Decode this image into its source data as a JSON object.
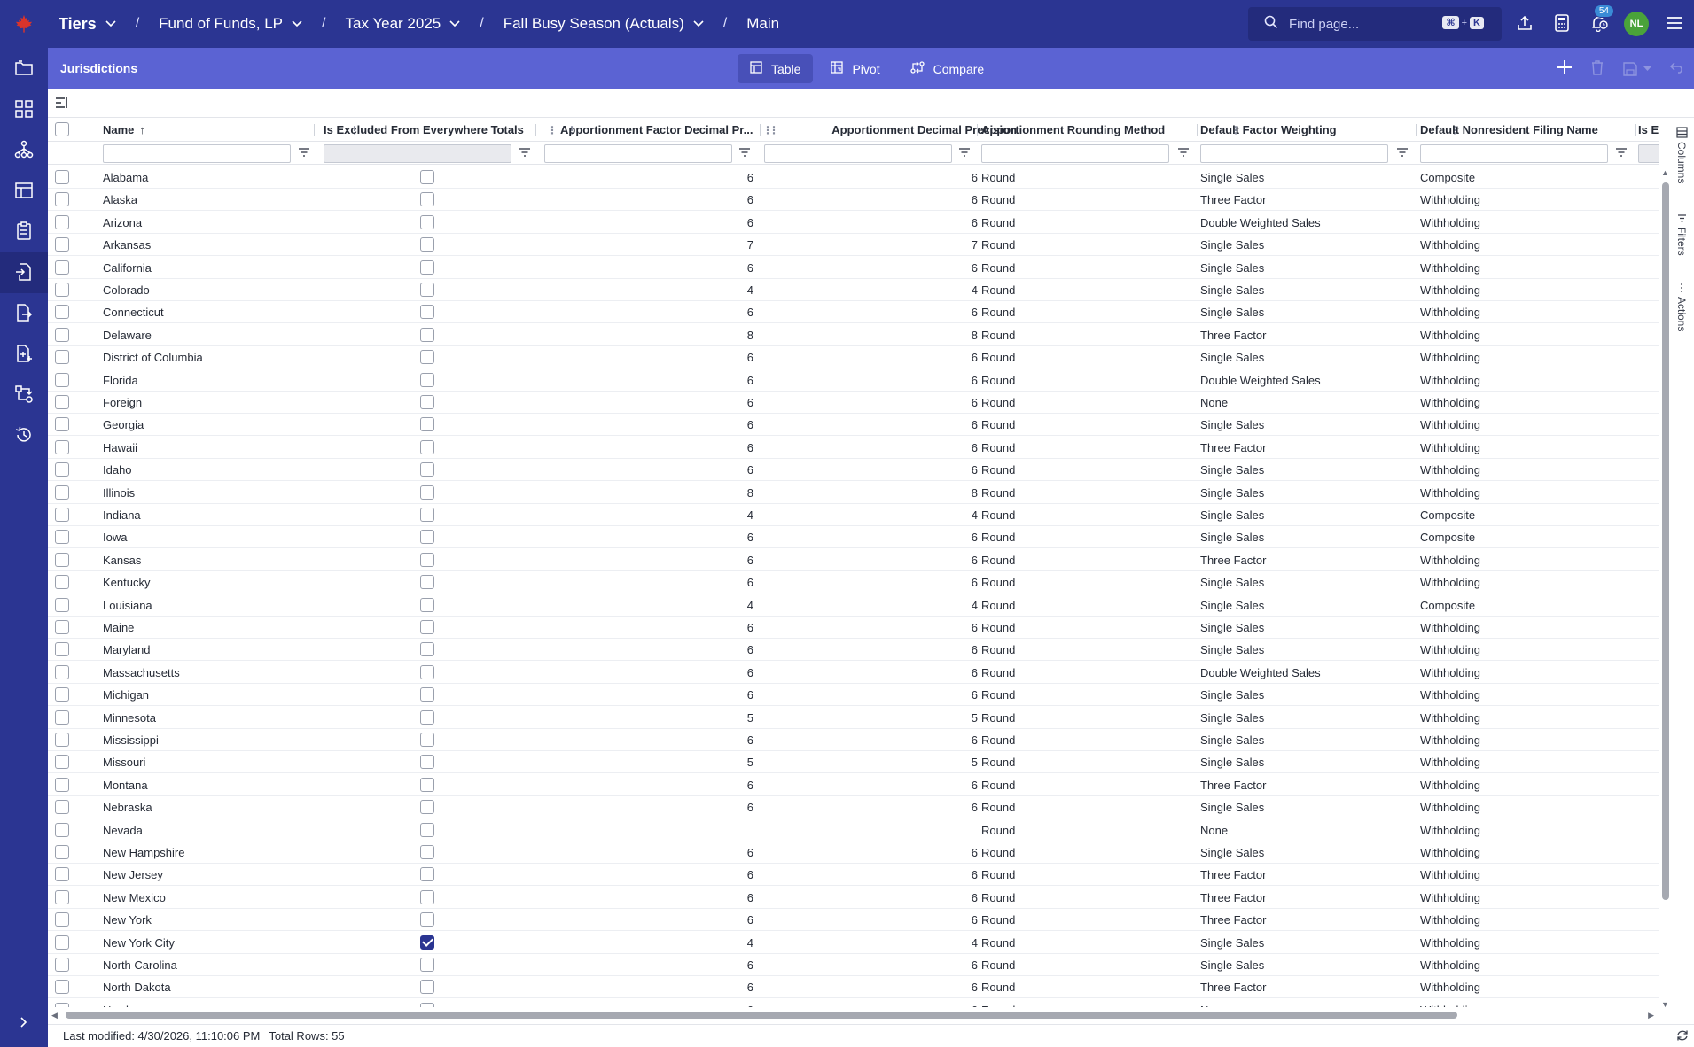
{
  "topbar": {
    "breadcrumbs": [
      "Tiers",
      "Fund of Funds, LP",
      "Tax Year 2025",
      "Fall Busy Season (Actuals)",
      "Main"
    ],
    "search_placeholder": "Find page...",
    "shortcut_mod": "⌘",
    "shortcut_plus": "+",
    "shortcut_key": "K",
    "notification_count": "54",
    "avatar_initials": "NL"
  },
  "subheader": {
    "title": "Jurisdictions",
    "tabs": [
      {
        "label": "Table",
        "icon": "table-icon",
        "active": true
      },
      {
        "label": "Pivot",
        "icon": "pivot-icon",
        "active": false
      },
      {
        "label": "Compare",
        "icon": "compare-icon",
        "active": false
      }
    ]
  },
  "grid": {
    "columns": [
      "Name",
      "Is Excluded From Everywhere Totals",
      "Apportionment Factor Decimal Pr...",
      "Apportionment Decimal Precision",
      "Apportionment Rounding Method",
      "Default Factor Weighting",
      "Default Nonresident Filing Name",
      "Is Excl"
    ],
    "sort_indicator": "↑",
    "rows": [
      [
        "Alabama",
        false,
        "6",
        "6",
        "Round",
        "Single Sales",
        "Composite"
      ],
      [
        "Alaska",
        false,
        "6",
        "6",
        "Round",
        "Three Factor",
        "Withholding"
      ],
      [
        "Arizona",
        false,
        "6",
        "6",
        "Round",
        "Double Weighted Sales",
        "Withholding"
      ],
      [
        "Arkansas",
        false,
        "7",
        "7",
        "Round",
        "Single Sales",
        "Withholding"
      ],
      [
        "California",
        false,
        "6",
        "6",
        "Round",
        "Single Sales",
        "Withholding"
      ],
      [
        "Colorado",
        false,
        "4",
        "4",
        "Round",
        "Single Sales",
        "Withholding"
      ],
      [
        "Connecticut",
        false,
        "6",
        "6",
        "Round",
        "Single Sales",
        "Withholding"
      ],
      [
        "Delaware",
        false,
        "8",
        "8",
        "Round",
        "Three Factor",
        "Withholding"
      ],
      [
        "District of Columbia",
        false,
        "6",
        "6",
        "Round",
        "Single Sales",
        "Withholding"
      ],
      [
        "Florida",
        false,
        "6",
        "6",
        "Round",
        "Double Weighted Sales",
        "Withholding"
      ],
      [
        "Foreign",
        false,
        "6",
        "6",
        "Round",
        "None",
        "Withholding"
      ],
      [
        "Georgia",
        false,
        "6",
        "6",
        "Round",
        "Single Sales",
        "Withholding"
      ],
      [
        "Hawaii",
        false,
        "6",
        "6",
        "Round",
        "Three Factor",
        "Withholding"
      ],
      [
        "Idaho",
        false,
        "6",
        "6",
        "Round",
        "Single Sales",
        "Withholding"
      ],
      [
        "Illinois",
        false,
        "8",
        "8",
        "Round",
        "Single Sales",
        "Withholding"
      ],
      [
        "Indiana",
        false,
        "4",
        "4",
        "Round",
        "Single Sales",
        "Composite"
      ],
      [
        "Iowa",
        false,
        "6",
        "6",
        "Round",
        "Single Sales",
        "Composite"
      ],
      [
        "Kansas",
        false,
        "6",
        "6",
        "Round",
        "Three Factor",
        "Withholding"
      ],
      [
        "Kentucky",
        false,
        "6",
        "6",
        "Round",
        "Single Sales",
        "Withholding"
      ],
      [
        "Louisiana",
        false,
        "4",
        "4",
        "Round",
        "Single Sales",
        "Composite"
      ],
      [
        "Maine",
        false,
        "6",
        "6",
        "Round",
        "Single Sales",
        "Withholding"
      ],
      [
        "Maryland",
        false,
        "6",
        "6",
        "Round",
        "Single Sales",
        "Withholding"
      ],
      [
        "Massachusetts",
        false,
        "6",
        "6",
        "Round",
        "Double Weighted Sales",
        "Withholding"
      ],
      [
        "Michigan",
        false,
        "6",
        "6",
        "Round",
        "Single Sales",
        "Withholding"
      ],
      [
        "Minnesota",
        false,
        "5",
        "5",
        "Round",
        "Single Sales",
        "Withholding"
      ],
      [
        "Mississippi",
        false,
        "6",
        "6",
        "Round",
        "Single Sales",
        "Withholding"
      ],
      [
        "Missouri",
        false,
        "5",
        "5",
        "Round",
        "Single Sales",
        "Withholding"
      ],
      [
        "Montana",
        false,
        "6",
        "6",
        "Round",
        "Three Factor",
        "Withholding"
      ],
      [
        "Nebraska",
        false,
        "6",
        "6",
        "Round",
        "Single Sales",
        "Withholding"
      ],
      [
        "Nevada",
        false,
        "",
        "",
        "Round",
        "None",
        "Withholding"
      ],
      [
        "New Hampshire",
        false,
        "6",
        "6",
        "Round",
        "Single Sales",
        "Withholding"
      ],
      [
        "New Jersey",
        false,
        "6",
        "6",
        "Round",
        "Three Factor",
        "Withholding"
      ],
      [
        "New Mexico",
        false,
        "6",
        "6",
        "Round",
        "Three Factor",
        "Withholding"
      ],
      [
        "New York",
        false,
        "6",
        "6",
        "Round",
        "Three Factor",
        "Withholding"
      ],
      [
        "New York City",
        true,
        "4",
        "4",
        "Round",
        "Single Sales",
        "Withholding"
      ],
      [
        "North Carolina",
        false,
        "6",
        "6",
        "Round",
        "Single Sales",
        "Withholding"
      ],
      [
        "North Dakota",
        false,
        "6",
        "6",
        "Round",
        "Three Factor",
        "Withholding"
      ],
      [
        "Nowhere",
        false,
        "6",
        "6",
        "Round",
        "None",
        "Withholding"
      ]
    ]
  },
  "side_panel": {
    "columns_label": "Columns",
    "filters_label": "Filters",
    "actions_label": "Actions"
  },
  "status": {
    "last_modified": "Last modified: 4/30/2026, 11:10:06 PM",
    "total_rows": "Total Rows: 55"
  },
  "colors": {
    "brand": "#2b3592",
    "subheader": "#5b63d3",
    "accent": "#2b3592",
    "logo": "#d9342b",
    "avatar": "#4aa33a"
  }
}
